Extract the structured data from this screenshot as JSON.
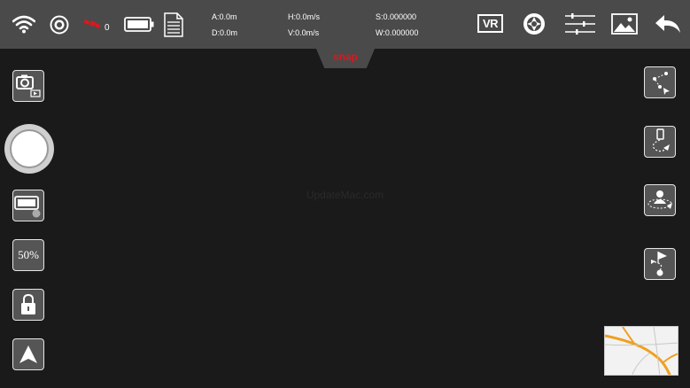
{
  "topbar": {
    "satellite_count": "0",
    "telemetry": {
      "altitude": "A:0.0m",
      "distance": "D:0.0m",
      "h_speed": "H:0.0m/s",
      "v_speed": "V:0.0m/s",
      "s_value": "S:0.000000",
      "w_value": "W:0.000000"
    },
    "vr_label": "VR"
  },
  "snap_label": "snap",
  "left_controls": {
    "zoom_label": "50%"
  },
  "watermark": "UpdateMac.com",
  "colors": {
    "bar": "#4a4a4a",
    "background": "#1a1a1a",
    "snap_red": "#e0161c",
    "map_road": "#f0a020"
  }
}
